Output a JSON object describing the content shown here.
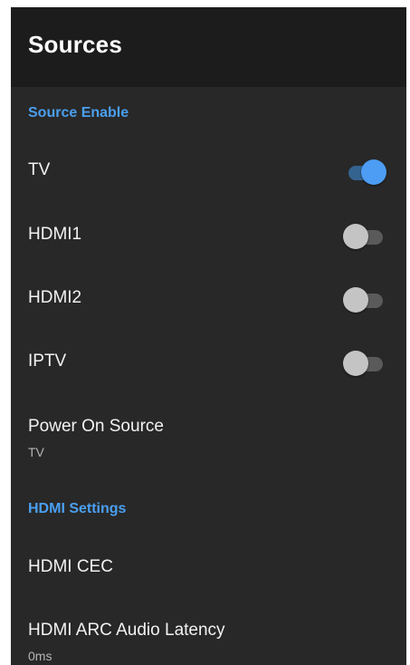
{
  "header": {
    "title": "Sources"
  },
  "sections": {
    "source_enable": "Source Enable",
    "hdmi_settings": "HDMI Settings"
  },
  "source_toggles": [
    {
      "label": "TV",
      "enabled": true
    },
    {
      "label": "HDMI1",
      "enabled": false
    },
    {
      "label": "HDMI2",
      "enabled": false
    },
    {
      "label": "IPTV",
      "enabled": false
    }
  ],
  "power_on_source": {
    "label": "Power On Source",
    "value": "TV"
  },
  "hdmi_cec": {
    "label": "HDMI CEC"
  },
  "hdmi_arc_latency": {
    "label": "HDMI ARC Audio Latency",
    "value": "0ms"
  },
  "colors": {
    "accent": "#4a9ff0",
    "background": "#282828",
    "header_background": "#1c1c1c",
    "toggle_on": "#4c9df3",
    "toggle_off": "#c4c4c4"
  }
}
